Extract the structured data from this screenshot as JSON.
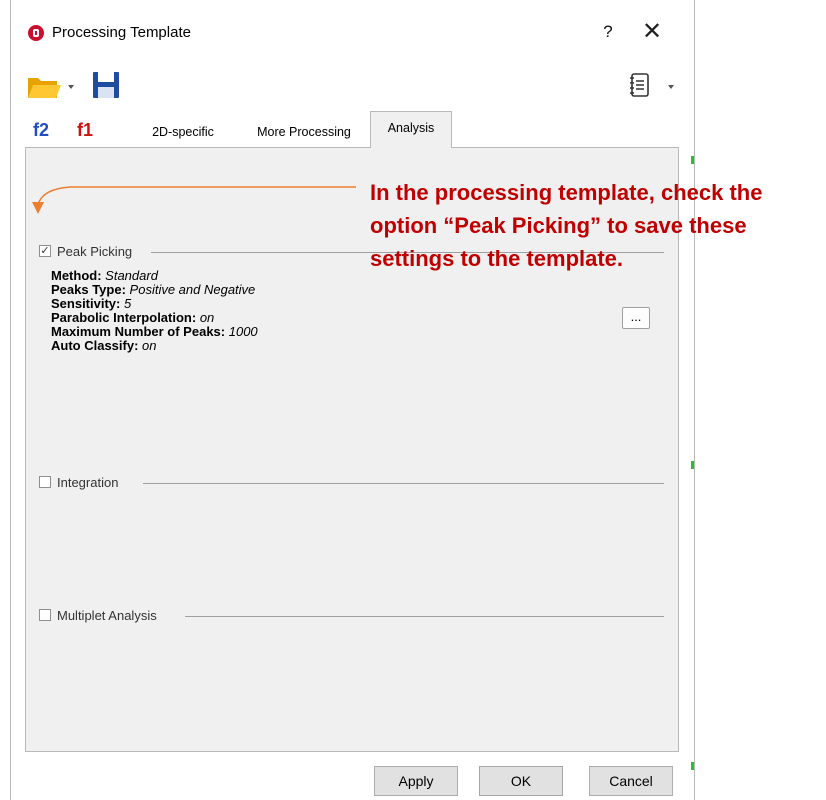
{
  "window": {
    "title": "Processing Template",
    "help_label": "?",
    "close_label": "✕"
  },
  "toolbar": {
    "open_icon": "folder-icon",
    "save_icon": "save-icon",
    "report_icon": "report-icon"
  },
  "tabs": [
    {
      "label": "f2",
      "color": "#1f4fbf"
    },
    {
      "label": "f1",
      "color": "#d01010"
    },
    {
      "label": "2D-specific"
    },
    {
      "label": "More Processing"
    },
    {
      "label": "Analysis",
      "active": true
    }
  ],
  "panel": {
    "peak_picking": {
      "label": "Peak Picking",
      "checked": true,
      "check_mark": "✓",
      "settings": [
        {
          "key": "Method:",
          "value": "Standard"
        },
        {
          "key": "Peaks Type:",
          "value": "Positive and Negative"
        },
        {
          "key": "Sensitivity:",
          "value": "5"
        },
        {
          "key": "Parabolic Interpolation:",
          "value": "on"
        },
        {
          "key": "Maximum Number of Peaks:",
          "value": "1000"
        },
        {
          "key": "Auto Classify:",
          "value": "on"
        }
      ],
      "options_button": "..."
    },
    "integration": {
      "label": "Integration",
      "checked": false
    },
    "multiplet": {
      "label": "Multiplet Analysis",
      "checked": false
    }
  },
  "buttons": {
    "apply": "Apply",
    "ok": "OK",
    "cancel": "Cancel"
  },
  "annotation": {
    "line1": "In the processing template, check the",
    "line2": "option “Peak Picking” to save these",
    "line3": "settings to the template.",
    "color": "#c00000",
    "arrow_color": "#ed7d31"
  }
}
